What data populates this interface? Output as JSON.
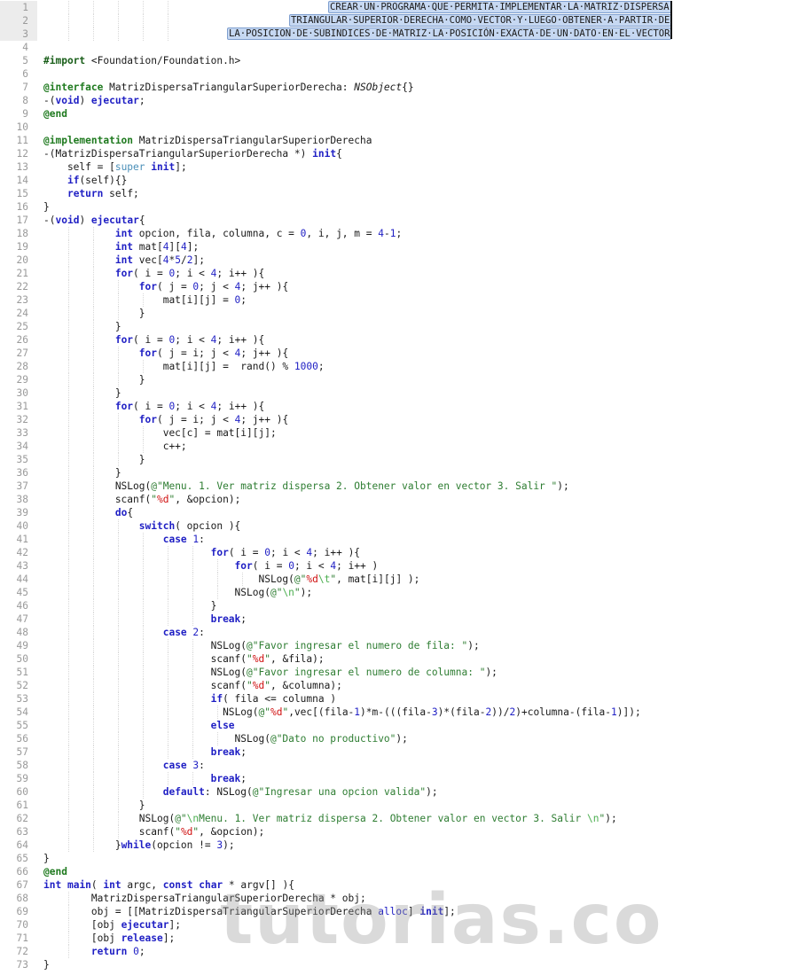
{
  "editor": {
    "language": "Objective-C",
    "highlighted_gutter_lines": [
      1,
      2,
      3
    ],
    "comment_block": [
      "CREAR·UN·PROGRAMA·QUE·PERMITA·IMPLEMENTAR·LA·MATRIZ·DISPERSA",
      "TRIANGULAR·SUPERIOR·DERECHA·COMO·VECTOR·Y·LUEGO·OBTENER·A·PARTIR·DE",
      "LA·POSICION·DE·SUBINDICES·DE·MATRIZ·LA·POSICIÓN·EXACTA·DE·UN·DATO·EN·EL·VECTOR"
    ],
    "lines": [
      {
        "n": "1",
        "text": ""
      },
      {
        "n": "2",
        "text": ""
      },
      {
        "n": "3",
        "text": ""
      },
      {
        "n": "4",
        "text": ""
      },
      {
        "n": "5",
        "text": "#import <Foundation/Foundation.h>"
      },
      {
        "n": "6",
        "text": ""
      },
      {
        "n": "7",
        "text": "@interface MatrizDispersaTriangularSuperiorDerecha: NSObject{}"
      },
      {
        "n": "8",
        "text": "-(void) ejecutar;"
      },
      {
        "n": "9",
        "text": "@end"
      },
      {
        "n": "10",
        "text": ""
      },
      {
        "n": "11",
        "text": "@implementation MatrizDispersaTriangularSuperiorDerecha"
      },
      {
        "n": "12",
        "text": "-(MatrizDispersaTriangularSuperiorDerecha *) init{"
      },
      {
        "n": "13",
        "text": "    self = [super init];"
      },
      {
        "n": "14",
        "text": "    if(self){}"
      },
      {
        "n": "15",
        "text": "    return self;"
      },
      {
        "n": "16",
        "text": "}"
      },
      {
        "n": "17",
        "text": "-(void) ejecutar{"
      },
      {
        "n": "18",
        "text": "            int opcion, fila, columna, c = 0, i, j, m = 4-1;"
      },
      {
        "n": "19",
        "text": "            int mat[4][4];"
      },
      {
        "n": "20",
        "text": "            int vec[4*5/2];"
      },
      {
        "n": "21",
        "text": "            for( i = 0; i < 4; i++ ){"
      },
      {
        "n": "22",
        "text": "                for( j = 0; j < 4; j++ ){"
      },
      {
        "n": "23",
        "text": "                    mat[i][j] = 0;"
      },
      {
        "n": "24",
        "text": "                }"
      },
      {
        "n": "25",
        "text": "            }"
      },
      {
        "n": "26",
        "text": "            for( i = 0; i < 4; i++ ){"
      },
      {
        "n": "27",
        "text": "                for( j = i; j < 4; j++ ){"
      },
      {
        "n": "28",
        "text": "                    mat[i][j] =  rand() % 1000;"
      },
      {
        "n": "29",
        "text": "                }"
      },
      {
        "n": "30",
        "text": "            }"
      },
      {
        "n": "31",
        "text": "            for( i = 0; i < 4; i++ ){"
      },
      {
        "n": "32",
        "text": "                for( j = i; j < 4; j++ ){"
      },
      {
        "n": "33",
        "text": "                    vec[c] = mat[i][j];"
      },
      {
        "n": "34",
        "text": "                    c++;"
      },
      {
        "n": "35",
        "text": "                }"
      },
      {
        "n": "36",
        "text": "            }"
      },
      {
        "n": "37",
        "text": "            NSLog(@\"Menu. 1. Ver matriz dispersa 2. Obtener valor en vector 3. Salir \");"
      },
      {
        "n": "38",
        "text": "            scanf(\"%d\", &opcion);"
      },
      {
        "n": "39",
        "text": "            do{"
      },
      {
        "n": "40",
        "text": "                switch( opcion ){"
      },
      {
        "n": "41",
        "text": "                    case 1:"
      },
      {
        "n": "42",
        "text": "                            for( i = 0; i < 4; i++ ){"
      },
      {
        "n": "43",
        "text": "                                for( i = 0; i < 4; i++ )"
      },
      {
        "n": "44",
        "text": "                                    NSLog(@\"%d\\t\", mat[i][j] );"
      },
      {
        "n": "45",
        "text": "                                NSLog(@\"\\n\");"
      },
      {
        "n": "46",
        "text": "                            }"
      },
      {
        "n": "47",
        "text": "                            break;"
      },
      {
        "n": "48",
        "text": "                    case 2:"
      },
      {
        "n": "49",
        "text": "                            NSLog(@\"Favor ingresar el numero de fila: \");"
      },
      {
        "n": "50",
        "text": "                            scanf(\"%d\", &fila);"
      },
      {
        "n": "51",
        "text": "                            NSLog(@\"Favor ingresar el numero de columna: \");"
      },
      {
        "n": "52",
        "text": "                            scanf(\"%d\", &columna);"
      },
      {
        "n": "53",
        "text": "                            if( fila <= columna )"
      },
      {
        "n": "54",
        "text": "                              NSLog(@\"%d\",vec[(fila-1)*m-(((fila-3)*(fila-2))/2)+columna-(fila-1)]);"
      },
      {
        "n": "55",
        "text": "                            else"
      },
      {
        "n": "56",
        "text": "                                NSLog(@\"Dato no productivo\");"
      },
      {
        "n": "57",
        "text": "                            break;"
      },
      {
        "n": "58",
        "text": "                    case 3:"
      },
      {
        "n": "59",
        "text": "                            break;"
      },
      {
        "n": "60",
        "text": "                    default: NSLog(@\"Ingresar una opcion valida\");"
      },
      {
        "n": "61",
        "text": "                }"
      },
      {
        "n": "62",
        "text": "                NSLog(@\"\\nMenu. 1. Ver matriz dispersa 2. Obtener valor en vector 3. Salir \\n\");"
      },
      {
        "n": "63",
        "text": "                scanf(\"%d\", &opcion);"
      },
      {
        "n": "64",
        "text": "            }while(opcion != 3);"
      },
      {
        "n": "65",
        "text": "}"
      },
      {
        "n": "66",
        "text": "@end"
      },
      {
        "n": "67",
        "text": "int main( int argc, const char * argv[] ){"
      },
      {
        "n": "68",
        "text": "        MatrizDispersaTriangularSuperiorDerecha * obj;"
      },
      {
        "n": "69",
        "text": "        obj = [[MatrizDispersaTriangularSuperiorDerecha alloc] init];"
      },
      {
        "n": "70",
        "text": "        [obj ejecutar];"
      },
      {
        "n": "71",
        "text": "        [obj release];"
      },
      {
        "n": "72",
        "text": "        return 0;"
      },
      {
        "n": "73",
        "text": "}"
      }
    ]
  },
  "watermark": "tutorias.co"
}
